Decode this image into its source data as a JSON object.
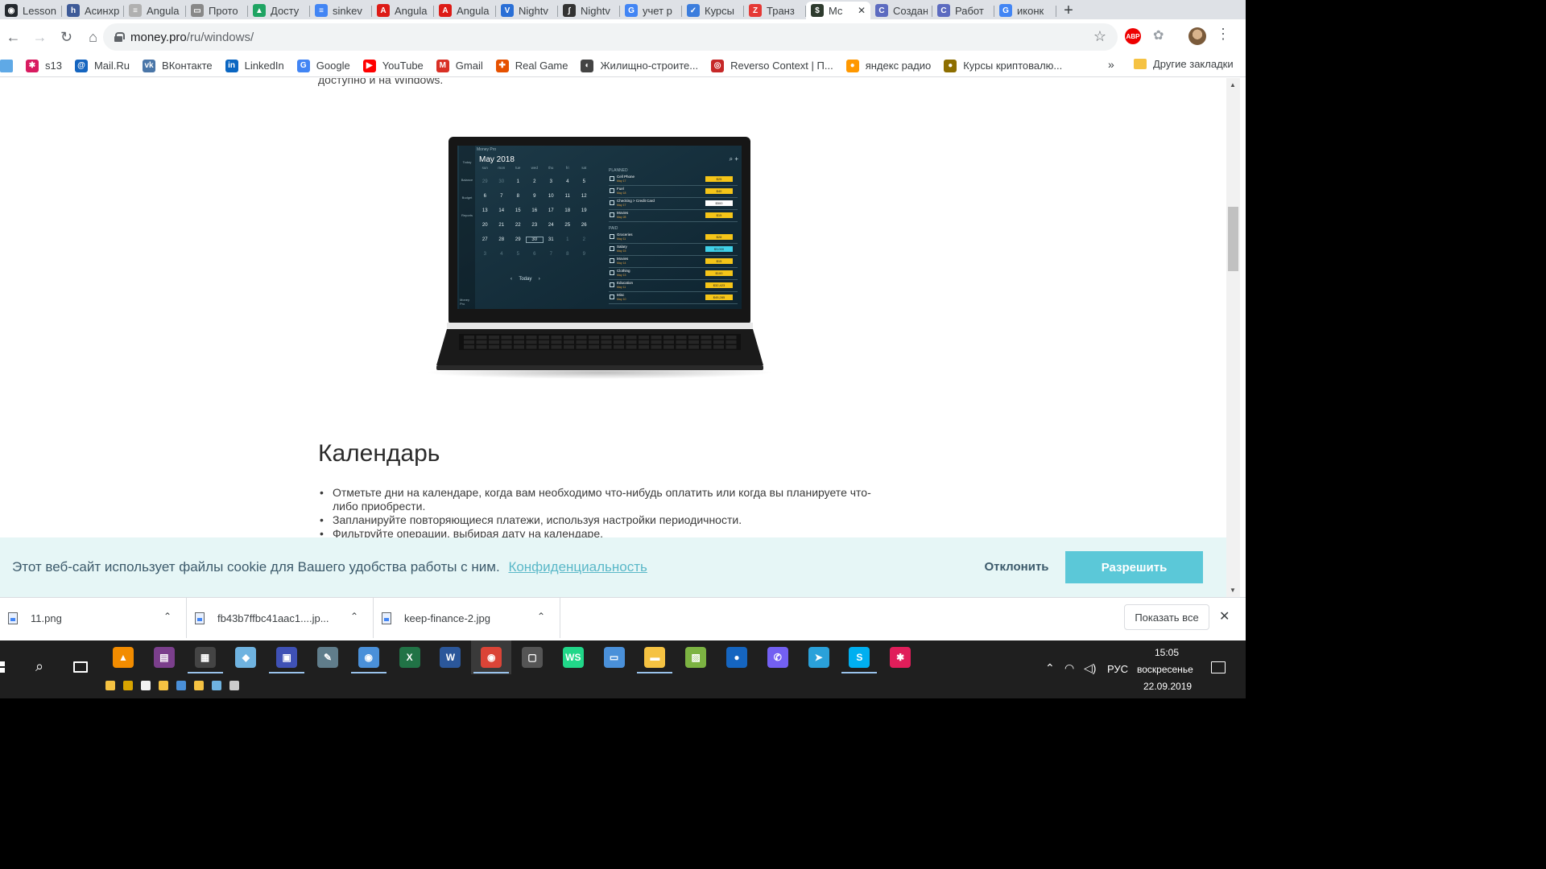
{
  "tabs": [
    {
      "label": "Lesson",
      "color": "#24292e",
      "glyph": "◉"
    },
    {
      "label": "Асинхр",
      "color": "#3d5a98",
      "glyph": "h"
    },
    {
      "label": "Angula",
      "color": "#b0b0b0",
      "glyph": "≡"
    },
    {
      "label": "Прото",
      "color": "#888888",
      "glyph": "▭"
    },
    {
      "label": "Досту",
      "color": "#1fa463",
      "glyph": "▲"
    },
    {
      "label": "sinkev",
      "color": "#4285f4",
      "glyph": "≡"
    },
    {
      "label": "Angula",
      "color": "#dd1b16",
      "glyph": "A"
    },
    {
      "label": "Angula",
      "color": "#dd1b16",
      "glyph": "A"
    },
    {
      "label": "Nightv",
      "color": "#2a6fd6",
      "glyph": "V"
    },
    {
      "label": "Nightv",
      "color": "#333333",
      "glyph": "∫"
    },
    {
      "label": "учет р",
      "color": "#4285f4",
      "glyph": "G"
    },
    {
      "label": "Курсы",
      "color": "#3b7ddd",
      "glyph": "✓"
    },
    {
      "label": "Транз",
      "color": "#e53935",
      "glyph": "Z"
    },
    {
      "label": "Mc",
      "color": "#2e3b2e",
      "glyph": "$",
      "active": true
    },
    {
      "label": "Создан",
      "color": "#5c6bc0",
      "glyph": "C"
    },
    {
      "label": "Работ",
      "color": "#5c6bc0",
      "glyph": "C"
    },
    {
      "label": "иконк",
      "color": "#4285f4",
      "glyph": "G"
    }
  ],
  "browser": {
    "url_host": "money.pro",
    "url_path": "/ru/windows/",
    "abp_label": "ABP"
  },
  "bookmarks": [
    {
      "label": "s13",
      "color": "#d81b60",
      "glyph": "✱"
    },
    {
      "label": "Mail.Ru",
      "color": "#1565c0",
      "glyph": "@"
    },
    {
      "label": "ВКонтакте",
      "color": "#4a76a8",
      "glyph": "vk"
    },
    {
      "label": "LinkedIn",
      "color": "#0a66c2",
      "glyph": "in"
    },
    {
      "label": "Google",
      "color": "#4285f4",
      "glyph": "G"
    },
    {
      "label": "YouTube",
      "color": "#ff0000",
      "glyph": "▶"
    },
    {
      "label": "Gmail",
      "color": "#d93025",
      "glyph": "M"
    },
    {
      "label": "Real Game",
      "color": "#e65100",
      "glyph": "✚"
    },
    {
      "label": "Жилищно-строите...",
      "color": "#444444",
      "glyph": "◐"
    },
    {
      "label": "Reverso Context | П...",
      "color": "#c62828",
      "glyph": "◎"
    },
    {
      "label": "яндекс радио",
      "color": "#ff9800",
      "glyph": "●"
    },
    {
      "label": "Курсы криптовалю...",
      "color": "#8d6e00",
      "glyph": "●"
    }
  ],
  "bookmarks_more": "»",
  "bookmarks_other": "Другие закладки",
  "page": {
    "intro_tail": "доступно и на Windows.",
    "heading": "Календарь",
    "bullets": [
      "Отметьте дни на календаре, когда вам необходимо что-нибудь оплатить или когда вы планируете что-либо приобрести.",
      "Запланируйте повторяющиеся платежи, используя настройки периодичности.",
      "Фильтруйте операции, выбирая дату на календаре."
    ]
  },
  "app_screen": {
    "app_name": "Money Pro",
    "month": "May 2018",
    "weekdays": [
      "sun",
      "mon",
      "tue",
      "wed",
      "thu",
      "fri",
      "sat"
    ],
    "weeks": [
      [
        "29",
        "30",
        "1",
        "2",
        "3",
        "4",
        "5"
      ],
      [
        "6",
        "7",
        "8",
        "9",
        "10",
        "11",
        "12"
      ],
      [
        "13",
        "14",
        "15",
        "16",
        "17",
        "18",
        "19"
      ],
      [
        "20",
        "21",
        "22",
        "23",
        "24",
        "25",
        "26"
      ],
      [
        "27",
        "28",
        "29",
        "30",
        "31",
        "1",
        "2"
      ],
      [
        "3",
        "4",
        "5",
        "6",
        "7",
        "8",
        "9"
      ]
    ],
    "today_label": "Today",
    "sidebar": [
      "Today",
      "Balance",
      "Budget",
      "Reports"
    ],
    "sidebar_bottom": "Money Pro",
    "planned_label": "PLANNED",
    "paid_label": "PAID",
    "planned": [
      {
        "name": "Cell Phone",
        "date": "May 17",
        "amount": "$25"
      },
      {
        "name": "Fuel",
        "date": "May 18",
        "amount": "$40"
      },
      {
        "name": "Checking > Credit Card",
        "date": "May 17",
        "amount": "$500"
      },
      {
        "name": "Movies",
        "date": "May 28",
        "amount": "$15"
      }
    ],
    "paid": [
      {
        "name": "Groceries",
        "date": "May 11",
        "amount": "$28"
      },
      {
        "name": "Salary",
        "date": "May 15",
        "amount": "$3,000"
      },
      {
        "name": "Movies",
        "date": "May 14",
        "amount": "$15"
      },
      {
        "name": "Clothing",
        "date": "May 13",
        "amount": "$100"
      },
      {
        "name": "Education",
        "date": "May 11",
        "amount": "$32,423"
      },
      {
        "name": "Misc",
        "date": "May 10",
        "amount": "$45,285"
      }
    ]
  },
  "cookie": {
    "text": "Этот веб-сайт использует файлы cookie для Вашего удобства работы с ним.",
    "link": "Конфиденциальность",
    "decline": "Отклонить",
    "allow": "Разрешить",
    "allow_color": "#5bc8d8"
  },
  "downloads": {
    "files": [
      "11.png",
      "fb43b7ffbc41aac1....jp...",
      "keep-finance-2.jpg"
    ],
    "show_all": "Показать все"
  },
  "taskbar": {
    "apps": [
      {
        "name": "vlc",
        "color": "#f28c00",
        "glyph": "▲"
      },
      {
        "name": "winrar",
        "color": "#7b3f8c",
        "glyph": "▤"
      },
      {
        "name": "calculator",
        "color": "#444444",
        "glyph": "▦"
      },
      {
        "name": "notepad",
        "color": "#6fb3e0",
        "glyph": "◆"
      },
      {
        "name": "save",
        "color": "#3f51b5",
        "glyph": "▣"
      },
      {
        "name": "paint",
        "color": "#607d8b",
        "glyph": "✎"
      },
      {
        "name": "photos",
        "color": "#4a90d9",
        "glyph": "◉"
      },
      {
        "name": "excel",
        "color": "#217346",
        "glyph": "X"
      },
      {
        "name": "word",
        "color": "#2b579a",
        "glyph": "W"
      },
      {
        "name": "chrome",
        "color": "#db4437",
        "glyph": "◉",
        "active": true
      },
      {
        "name": "window",
        "color": "#555555",
        "glyph": "▢"
      },
      {
        "name": "webstorm",
        "color": "#21d789",
        "glyph": "WS"
      },
      {
        "name": "explorer-win",
        "color": "#4a90d9",
        "glyph": "▭"
      },
      {
        "name": "file-explorer",
        "color": "#f5c242",
        "glyph": "▬"
      },
      {
        "name": "image-viewer",
        "color": "#7cb342",
        "glyph": "▨"
      },
      {
        "name": "maps",
        "color": "#1565c0",
        "glyph": "●"
      },
      {
        "name": "viber",
        "color": "#7360f2",
        "glyph": "✆"
      },
      {
        "name": "telegram",
        "color": "#2aa1da",
        "glyph": "➤"
      },
      {
        "name": "skype",
        "color": "#00aff0",
        "glyph": "S"
      },
      {
        "name": "slack",
        "color": "#e01e5a",
        "glyph": "✱"
      }
    ],
    "lang": "РУС",
    "time": "15:05",
    "day": "воскресенье",
    "date": "22.09.2019"
  }
}
